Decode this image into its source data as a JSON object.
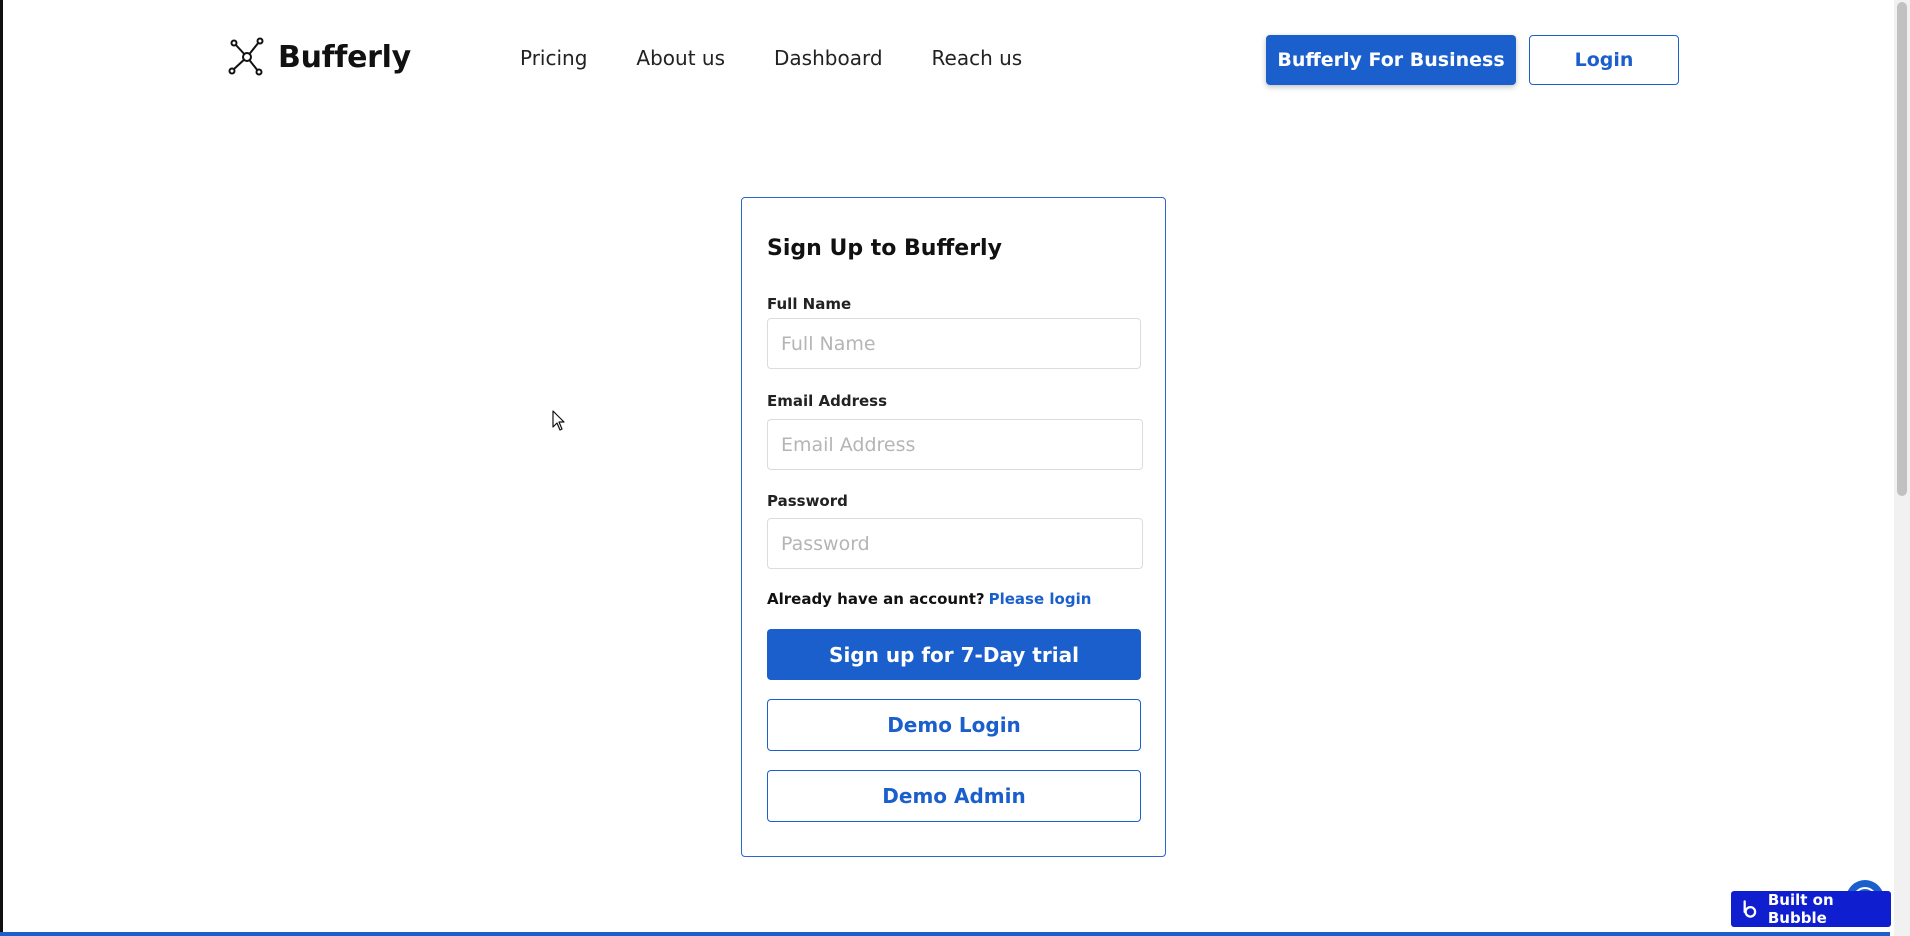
{
  "header": {
    "brand": "Bufferly",
    "nav": [
      {
        "label": "Pricing"
      },
      {
        "label": "About us"
      },
      {
        "label": "Dashboard"
      },
      {
        "label": "Reach us"
      }
    ],
    "business_button": "Bufferly For Business",
    "login_button": "Login"
  },
  "form": {
    "title": "Sign Up to Bufferly",
    "full_name_label": "Full Name",
    "full_name_placeholder": "Full Name",
    "full_name_value": "",
    "email_label": "Email Address",
    "email_placeholder": "Email Address",
    "email_value": "",
    "password_label": "Password",
    "password_placeholder": "Password",
    "password_value": "",
    "already_text": "Already have an account?",
    "please_login": "Please login",
    "signup_button": "Sign up for 7-Day trial",
    "demo_login_button": "Demo Login",
    "demo_admin_button": "Demo Admin"
  },
  "badge": {
    "label": "Built on Bubble"
  },
  "colors": {
    "primary": "#1b5fcc",
    "badge": "#0f1fd0",
    "background": "#ffffff"
  },
  "icons": {
    "logo": "network-nodes-icon",
    "badge": "bubble-logo-icon",
    "cursor": "mouse-pointer-icon"
  }
}
